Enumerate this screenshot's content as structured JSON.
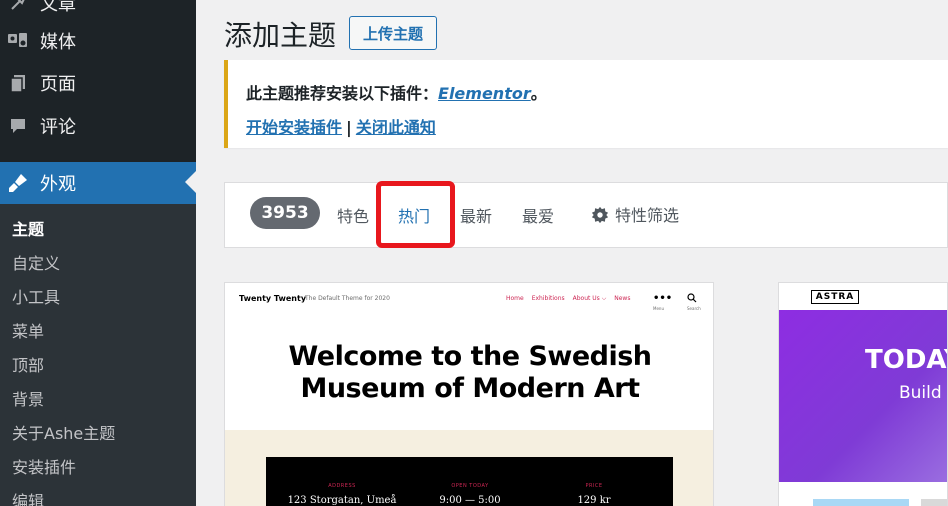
{
  "sidebar": {
    "items": [
      {
        "label": "文章",
        "icon": "pin-icon"
      },
      {
        "label": "媒体",
        "icon": "media-icon"
      },
      {
        "label": "页面",
        "icon": "page-icon"
      },
      {
        "label": "评论",
        "icon": "comment-icon"
      },
      {
        "label": "外观",
        "icon": "appearance-icon",
        "active": true
      }
    ],
    "submenu": [
      {
        "label": "主题",
        "current": true
      },
      {
        "label": "自定义"
      },
      {
        "label": "小工具"
      },
      {
        "label": "菜单"
      },
      {
        "label": "顶部"
      },
      {
        "label": "背景"
      },
      {
        "label": "关于Ashe主题"
      },
      {
        "label": "安装插件"
      },
      {
        "label": "编辑"
      }
    ]
  },
  "header": {
    "title": "添加主题",
    "upload_label": "上传主题"
  },
  "notice": {
    "text_prefix": "此主题推荐安装以下插件：",
    "plugin_link": "Elementor",
    "text_suffix": "。",
    "install_link": "开始安装插件",
    "separator": "|",
    "dismiss_link": "关闭此通知"
  },
  "filter": {
    "count": "3953",
    "tabs": [
      "特色",
      "热门",
      "最新",
      "最爱"
    ],
    "current_tab": "热门",
    "feature_filter": "特性筛选"
  },
  "themes": {
    "twenty_twenty": {
      "logo": "Twenty Twenty",
      "tagline": "The Default Theme for 2020",
      "nav": [
        "Home",
        "Exhibitions",
        "About Us ⌵",
        "News"
      ],
      "menu_label": "Menu",
      "search_label": "Search",
      "heading_line1": "Welcome to the Swedish",
      "heading_line2": "Museum of Modern Art",
      "info": [
        {
          "label": "ADDRESS",
          "value": "123 Storgatan, Umeå"
        },
        {
          "label": "OPEN TODAY",
          "value": "9:00 — 5:00"
        },
        {
          "label": "PRICE",
          "value": "129 kr"
        }
      ],
      "accent_color": "#cd2653"
    },
    "astra": {
      "logo": "ASTRA",
      "hero_title": "TODAY",
      "hero_sub": "Build Y",
      "hero_color": "#8e2de2"
    }
  },
  "colors": {
    "sidebar_bg": "#1d2327",
    "active_bg": "#2271b1",
    "link": "#2271b1",
    "highlight": "#e8171d",
    "notice_border": "#dba617"
  }
}
